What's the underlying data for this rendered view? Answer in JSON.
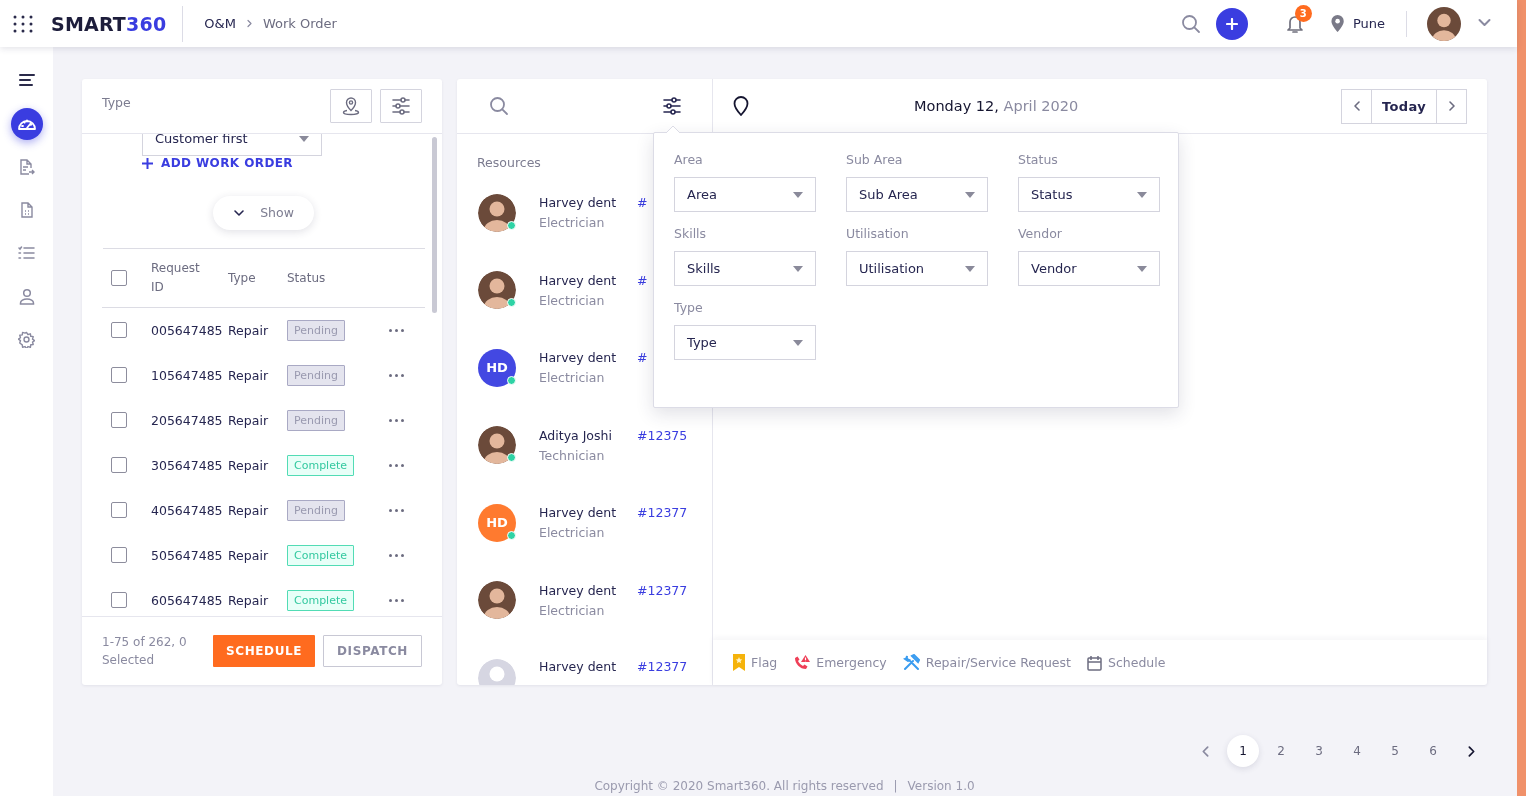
{
  "header": {
    "logo": {
      "text": "SMART",
      "accent": "360"
    },
    "breadcrumb": [
      "O&M",
      "Work Order"
    ],
    "notifications": "3",
    "location": "Pune"
  },
  "sidebar": {
    "items": [
      {
        "kind": "menu",
        "selected": false
      },
      {
        "kind": "dashboard",
        "selected": true
      },
      {
        "kind": "export",
        "selected": false
      },
      {
        "kind": "document",
        "selected": false
      },
      {
        "kind": "checklist",
        "selected": false
      },
      {
        "kind": "user",
        "selected": false
      },
      {
        "kind": "settings",
        "selected": false
      }
    ]
  },
  "work_orders": {
    "type_label": "Type",
    "type_select": "Customer first",
    "add_link": "ADD WORK ORDER",
    "show_button": "Show",
    "select_all": false,
    "columns": [
      "Request ID",
      "Type",
      "Status"
    ],
    "rows": [
      {
        "id": "005647485",
        "type": "Repair",
        "status": "Pending",
        "kind": "pending",
        "checked": false
      },
      {
        "id": "105647485",
        "type": "Repair",
        "status": "Pending",
        "kind": "pending",
        "checked": false
      },
      {
        "id": "205647485",
        "type": "Repair",
        "status": "Pending",
        "kind": "pending",
        "checked": false
      },
      {
        "id": "305647485",
        "type": "Repair",
        "status": "Complete",
        "kind": "complete",
        "checked": false
      },
      {
        "id": "405647485",
        "type": "Repair",
        "status": "Pending",
        "kind": "pending",
        "checked": false
      },
      {
        "id": "505647485",
        "type": "Repair",
        "status": "Complete",
        "kind": "complete",
        "checked": false
      },
      {
        "id": "605647485",
        "type": "Repair",
        "status": "Complete",
        "kind": "complete",
        "checked": false
      }
    ],
    "summary": "1-75 of 262, 0 Selected",
    "buttons": [
      {
        "label": "SCHEDULE",
        "kind": "primary"
      },
      {
        "label": "DISPATCH",
        "kind": "secondary"
      }
    ]
  },
  "resources": {
    "title": "Resources",
    "items": [
      {
        "name": "Harvey dent",
        "role": "Electrician",
        "ref": "#",
        "kind": "photo",
        "online": true
      },
      {
        "name": "Harvey dent",
        "role": "Electrician",
        "ref": "#",
        "kind": "photo",
        "online": true
      },
      {
        "name": "Harvey dent",
        "role": "Electrician",
        "ref": "#",
        "kind": "initials",
        "initials": "HD",
        "color": "#4348e2",
        "online": true
      },
      {
        "name": "Aditya Joshi",
        "role": "Technician",
        "ref": "#12375",
        "kind": "photo",
        "online": true
      },
      {
        "name": "Harvey dent",
        "role": "Electrician",
        "ref": "#12377",
        "kind": "initials",
        "initials": "HD",
        "color": "#ff7a2f",
        "online": true
      },
      {
        "name": "Harvey dent",
        "role": "Electrician",
        "ref": "#12377",
        "kind": "photo",
        "online": false
      },
      {
        "name": "Harvey dent",
        "ref": "#12377",
        "kind": "placeholder",
        "online": false
      }
    ]
  },
  "calendar": {
    "date": "**Monday 12,** April 2020",
    "today": "Today",
    "legend": [
      {
        "label": "Flag",
        "kind": "flag"
      },
      {
        "label": "Emergency",
        "kind": "emergency"
      },
      {
        "label": "Repair/Service Request",
        "kind": "repair"
      },
      {
        "label": "Schedule",
        "kind": "schedule"
      }
    ]
  },
  "filter_popover": {
    "open": true,
    "fields": [
      {
        "label": "Area",
        "value": "Area"
      },
      {
        "label": "Sub Area",
        "value": "Sub Area"
      },
      {
        "label": "Status",
        "value": "Status"
      },
      {
        "label": "Skills",
        "value": "Skills"
      },
      {
        "label": "Utilisation",
        "value": "Utilisation"
      },
      {
        "label": "Vendor",
        "value": "Vendor"
      },
      {
        "label": "Type",
        "value": "Type"
      }
    ]
  },
  "pagination": {
    "pages": [
      {
        "label": "1",
        "selected": true
      },
      {
        "label": "2",
        "selected": false
      },
      {
        "label": "3",
        "selected": false
      },
      {
        "label": "4",
        "selected": false
      },
      {
        "label": "5",
        "selected": false
      },
      {
        "label": "6",
        "selected": false
      }
    ]
  },
  "footer": {
    "copyright": "Copyright © 2020 Smart360. All rights reserved",
    "separator": "|",
    "version": "Version 1.0"
  }
}
